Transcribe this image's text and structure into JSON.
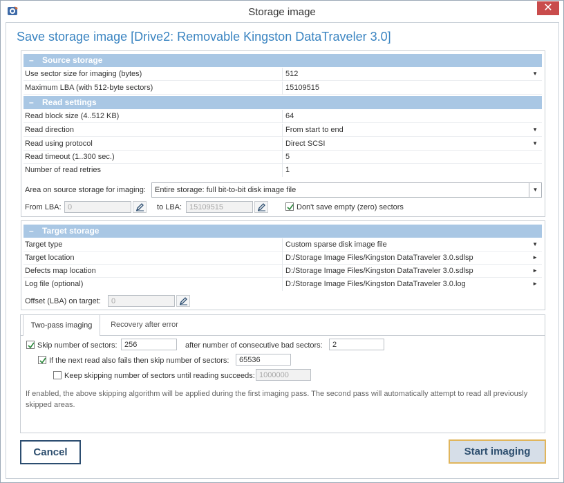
{
  "window": {
    "title": "Storage image",
    "close_glyph": "✕"
  },
  "heading": "Save storage image [Drive2: Removable Kingston DataTraveler 3.0]",
  "source_storage": {
    "header": "Source storage",
    "collapse_glyph": "–",
    "rows": [
      {
        "label": "Use sector size for imaging (bytes)",
        "value": "512"
      },
      {
        "label": "Maximum LBA (with 512-byte sectors)",
        "value": "15109515"
      }
    ]
  },
  "read_settings": {
    "header": "Read settings",
    "collapse_glyph": "–",
    "rows": [
      {
        "label": "Read block size (4..512 KB)",
        "value": "64"
      },
      {
        "label": "Read direction",
        "value": "From start to end"
      },
      {
        "label": "Read using protocol",
        "value": "Direct SCSI"
      },
      {
        "label": "Read timeout (1..300 sec.)",
        "value": "5"
      },
      {
        "label": "Number of read retries",
        "value": "1"
      }
    ],
    "area_label": "Area on source storage for imaging:",
    "area_value": "Entire storage: full bit-to-bit disk image file",
    "from_lba_label": "From LBA:",
    "from_lba_value": "0",
    "to_lba_label": "to LBA:",
    "to_lba_value": "15109515",
    "dont_save_empty_label": "Don't save empty (zero) sectors",
    "dont_save_empty_checked": true
  },
  "target_storage": {
    "header": "Target storage",
    "collapse_glyph": "–",
    "rows": [
      {
        "label": "Target type",
        "value": "Custom sparse disk image file"
      },
      {
        "label": "Target location",
        "value": "D:/Storage Image Files/Kingston DataTraveler 3.0.sdlsp"
      },
      {
        "label": "Defects map location",
        "value": "D:/Storage Image Files/Kingston DataTraveler 3.0.sdlsp"
      },
      {
        "label": "Log file (optional)",
        "value": "D:/Storage Image Files/Kingston DataTraveler 3.0.log"
      }
    ],
    "offset_label": "Offset (LBA) on target:",
    "offset_value": "0"
  },
  "tabs": [
    {
      "label": "Two-pass imaging",
      "active": true
    },
    {
      "label": "Recovery after error",
      "active": false
    }
  ],
  "two_pass": {
    "skip_label": "Skip number of sectors:",
    "skip_value": "256",
    "skip_checked": true,
    "after_label": "after number of consecutive bad sectors:",
    "after_value": "2",
    "next_read_label": "If the next read also fails then skip number of sectors:",
    "next_read_value": "65536",
    "next_read_checked": true,
    "keep_label": "Keep skipping number of sectors until reading succeeds:",
    "keep_value": "1000000",
    "keep_checked": false,
    "note": "If enabled, the above skipping algorithm will be applied during the first imaging pass. The second pass will automatically attempt to read all previously skipped areas."
  },
  "buttons": {
    "cancel": "Cancel",
    "start": "Start imaging"
  },
  "glyphs": {
    "dropdown": "▼",
    "arrow_right": "►"
  },
  "colors": {
    "accent": "#3a84c1",
    "section_header": "#a9c7e4",
    "close": "#c94c4c",
    "start_border": "#e0b55c"
  }
}
